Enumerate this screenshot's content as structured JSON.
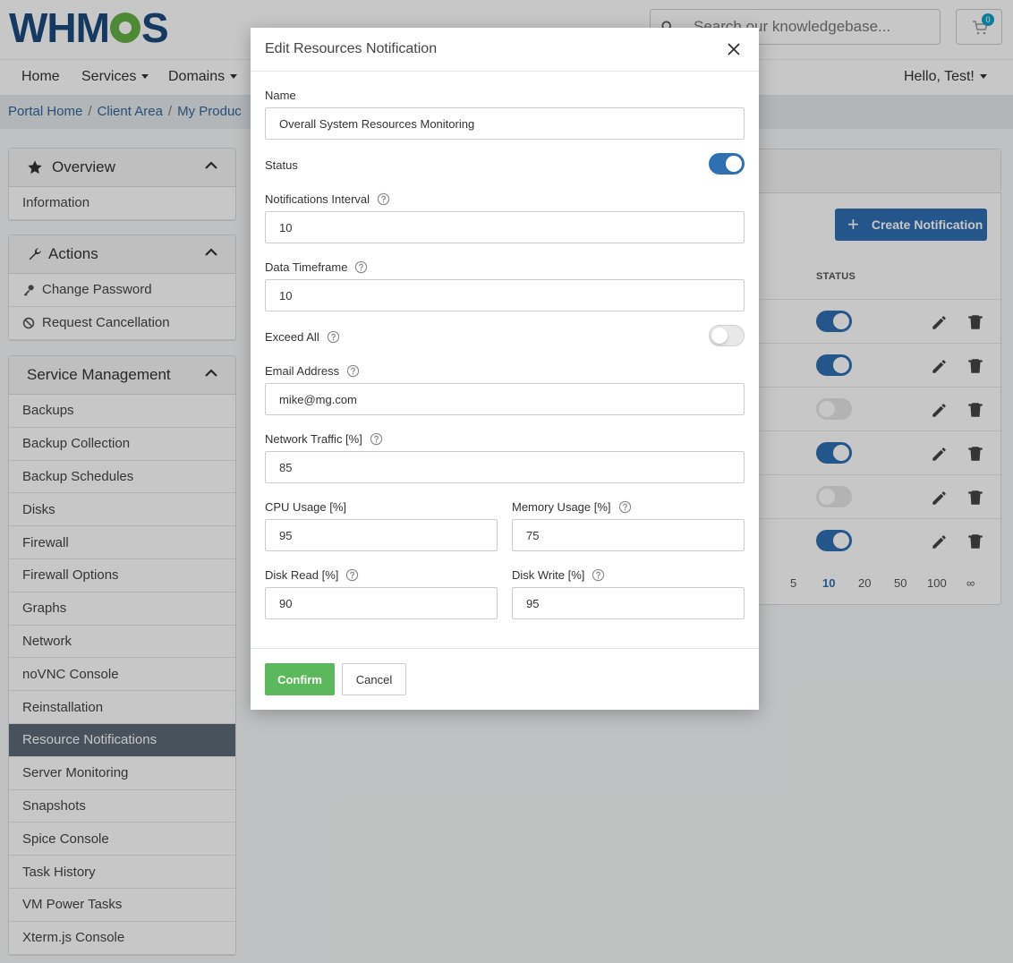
{
  "header": {
    "logo_text": "WHM",
    "logo_suffix": "S",
    "search_placeholder": "Search our knowledgebase...",
    "cart_count": "0"
  },
  "nav": {
    "home": "Home",
    "services": "Services",
    "domains": "Domains",
    "user": "Hello, Test!"
  },
  "breadcrumb": [
    "Portal Home",
    "Client Area",
    "My Produc"
  ],
  "sidebar": {
    "overview": {
      "title": "Overview",
      "items": [
        "Information"
      ]
    },
    "actions": {
      "title": "Actions",
      "items": [
        "Change Password",
        "Request Cancellation"
      ]
    },
    "service_management": {
      "title": "Service Management",
      "items": [
        "Backups",
        "Backup Collection",
        "Backup Schedules",
        "Disks",
        "Firewall",
        "Firewall Options",
        "Graphs",
        "Network",
        "noVNC Console",
        "Reinstallation",
        "Resource Notifications",
        "Server Monitoring",
        "Snapshots",
        "Spice Console",
        "Task History",
        "VM Power Tasks",
        "Xterm.js Console"
      ],
      "active": "Resource Notifications"
    }
  },
  "panel": {
    "create_button": "Create Notification",
    "status_header": "STATUS",
    "row_status": [
      true,
      true,
      false,
      true,
      false,
      true
    ],
    "page_sizes": [
      "5",
      "10",
      "20",
      "50",
      "100",
      "∞"
    ],
    "page_size_active": "10"
  },
  "modal": {
    "title": "Edit Resources Notification",
    "name_label": "Name",
    "name_value": "Overall System Resources Monitoring",
    "status_label": "Status",
    "status_on": true,
    "interval_label": "Notifications Interval",
    "interval_value": "10",
    "timeframe_label": "Data Timeframe",
    "timeframe_value": "10",
    "exceed_label": "Exceed All",
    "exceed_on": false,
    "email_label": "Email Address",
    "email_value": "mike@mg.com",
    "network_label": "Network Traffic [%]",
    "network_value": "85",
    "cpu_label": "CPU Usage [%]",
    "cpu_value": "95",
    "memory_label": "Memory Usage [%]",
    "memory_value": "75",
    "disk_read_label": "Disk Read [%]",
    "disk_read_value": "90",
    "disk_write_label": "Disk Write [%]",
    "disk_write_value": "95",
    "confirm_label": "Confirm",
    "cancel_label": "Cancel"
  },
  "colors": {
    "primary": "#2f6fb3",
    "confirm": "#5cb85c",
    "sidebar_active": "#5d6977"
  }
}
